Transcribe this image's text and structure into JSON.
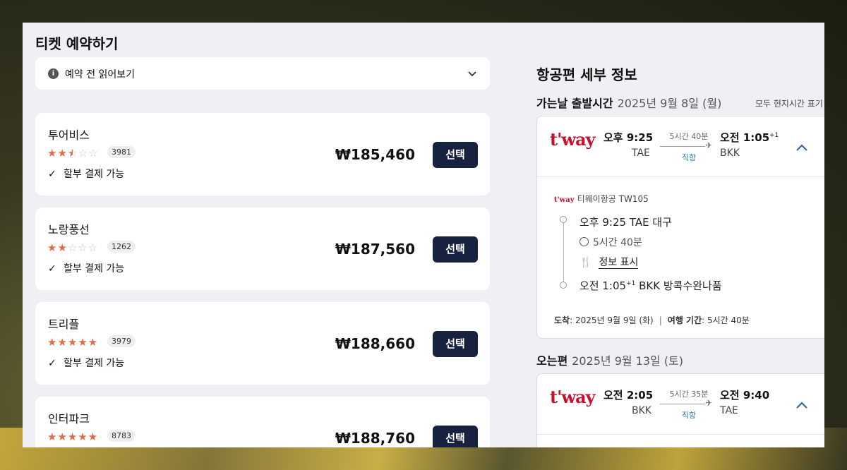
{
  "left": {
    "title": "티켓 예약하기",
    "notice": "예약 전 읽어보기",
    "vendors": [
      {
        "name": "투어비스",
        "rating": 2.5,
        "reviews": "3981",
        "installment": "할부 결제 가능",
        "price": "₩185,460",
        "select": "선택"
      },
      {
        "name": "노랑풍선",
        "rating": 2,
        "reviews": "1262",
        "installment": "할부 결제 가능",
        "price": "₩187,560",
        "select": "선택"
      },
      {
        "name": "트리플",
        "rating": 5,
        "reviews": "3979",
        "installment": "할부 결제 가능",
        "price": "₩188,660",
        "select": "선택"
      },
      {
        "name": "인터파크",
        "rating": 5,
        "reviews": "8783",
        "installment": "",
        "price": "₩188,760",
        "select": "선택"
      }
    ]
  },
  "right": {
    "title": "항공편 세부 정보",
    "local_time_note": "모두 현지시간 표기",
    "outbound": {
      "label": "가는날 출발시간",
      "date": "2025년 9월 8일 (월)",
      "logo": "t'way",
      "dep_time": "오후 9:25",
      "dep_code": "TAE",
      "duration": "5시간 40분",
      "direct": "직항",
      "arr_time": "오전 1:05",
      "arr_plus": "+1",
      "arr_code": "BKK",
      "detail": {
        "airline_mini": "t'way",
        "airline": "티웨이항공 TW105",
        "dep": "오후 9:25 TAE 대구",
        "duration": "5시간 40분",
        "meal": "정보 표시",
        "arr": "오전 1:05",
        "arr_plus": "+1",
        "arr_rest": "BKK 방콕수완나품",
        "arrival_label": "도착",
        "arrival_value": ": 2025년 9월 9일 (화)",
        "trip_label": "여행 기간",
        "trip_value": ": 5시간 40분"
      }
    },
    "inbound": {
      "label": "오는편",
      "date": "2025년 9월 13일 (토)",
      "logo": "t'way",
      "dep_time": "오전 2:05",
      "dep_code": "BKK",
      "duration": "5시간 35분",
      "direct": "직항",
      "arr_time": "오전 9:40",
      "arr_code": "TAE"
    }
  }
}
